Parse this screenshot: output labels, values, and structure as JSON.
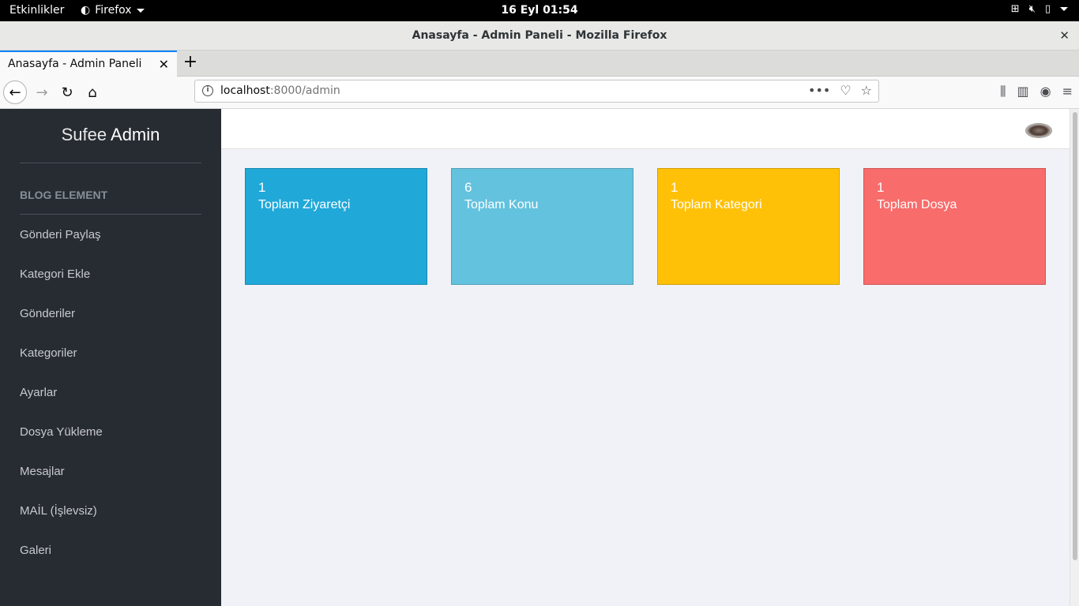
{
  "system": {
    "activities": "Etkinlikler",
    "app_name": "Firefox",
    "clock": "16 Eyl  01:54"
  },
  "window": {
    "title": "Anasayfa - Admin Paneli - Mozilla Firefox",
    "close": "✕"
  },
  "browser": {
    "tab_title": "Anasayfa - Admin Paneli",
    "url_host": "localhost",
    "url_rest": ":8000/admin"
  },
  "sidebar": {
    "brand_light": "Sufee ",
    "brand_bold": "Admin",
    "section_title": "BLOG ELEMENT",
    "items": [
      {
        "label": "Gönderi Paylaş"
      },
      {
        "label": "Kategori Ekle"
      },
      {
        "label": "Gönderiler"
      },
      {
        "label": "Kategoriler"
      },
      {
        "label": "Ayarlar"
      },
      {
        "label": "Dosya Yükleme"
      },
      {
        "label": "Mesajlar"
      },
      {
        "label": "MAİL (İşlevsiz)"
      },
      {
        "label": "Galeri"
      }
    ]
  },
  "cards": [
    {
      "count": "1",
      "label": "Toplam Ziyaretçi",
      "color": "#20a8d8"
    },
    {
      "count": "6",
      "label": "Toplam Konu",
      "color": "#63c2de"
    },
    {
      "count": "1",
      "label": "Toplam Kategori",
      "color": "#ffc107"
    },
    {
      "count": "1",
      "label": "Toplam Dosya",
      "color": "#f86c6b"
    }
  ]
}
